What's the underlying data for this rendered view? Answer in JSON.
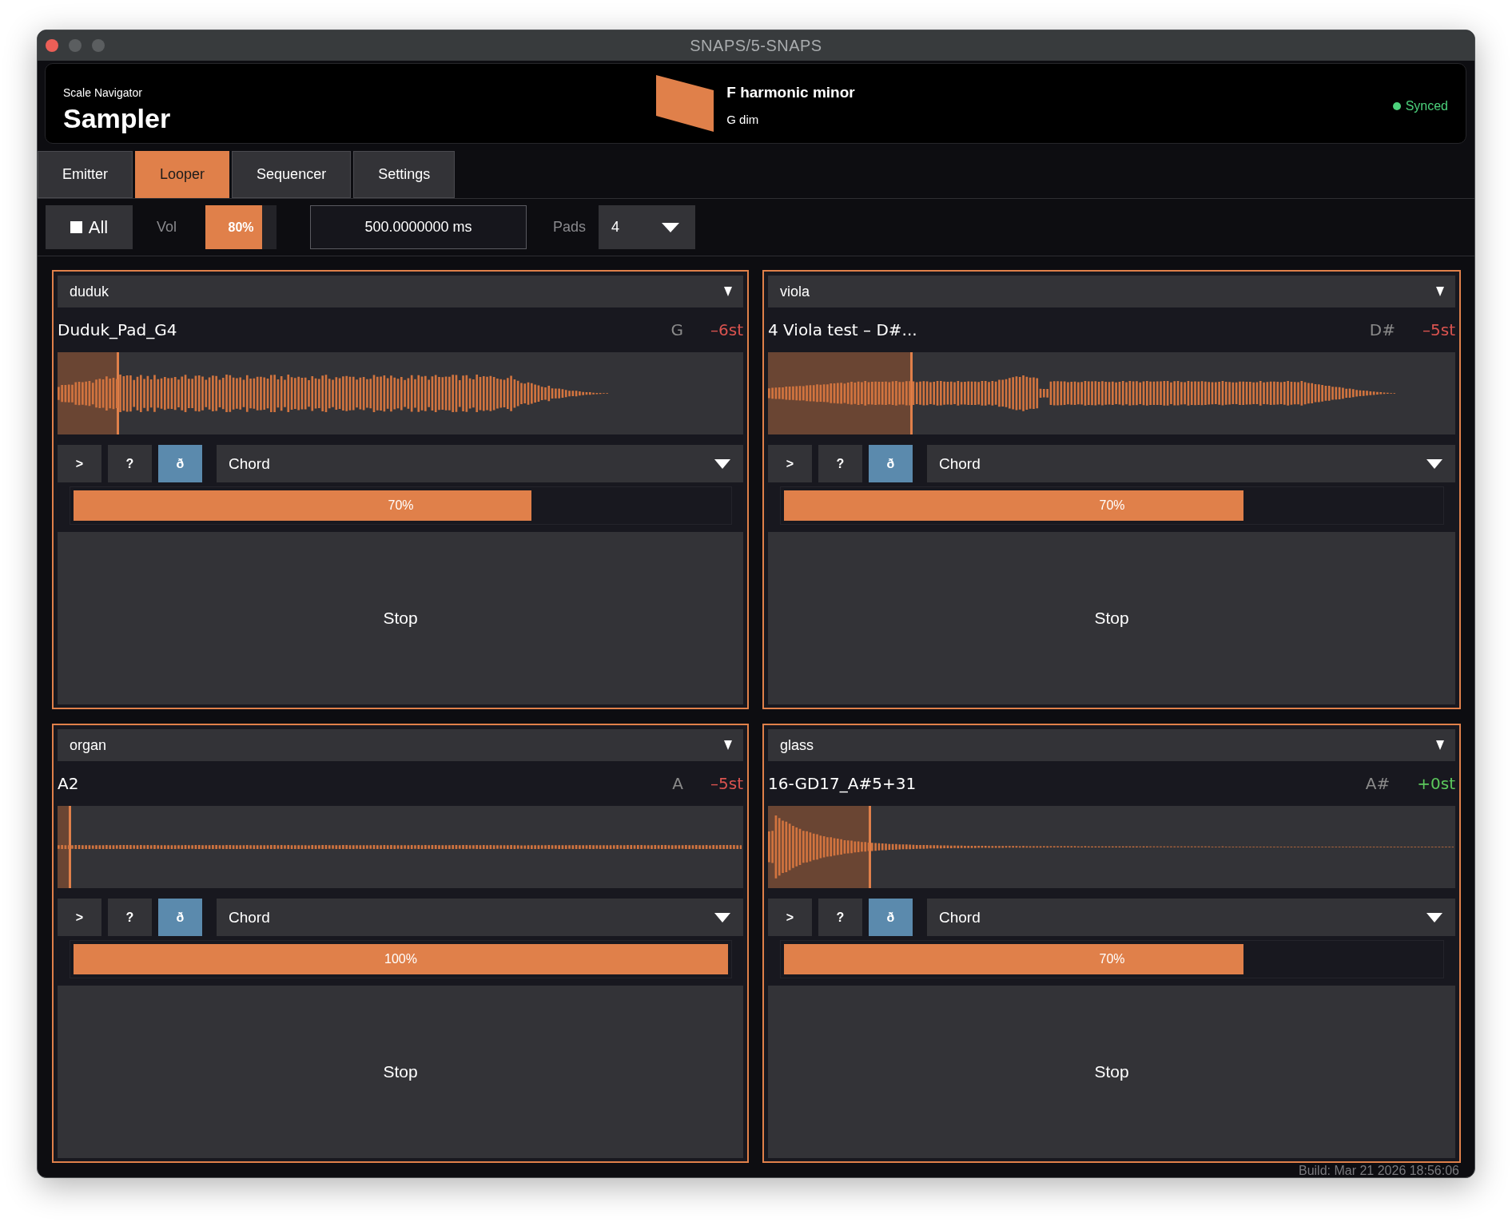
{
  "window": {
    "title": "SNAPS/5-SNAPS"
  },
  "header": {
    "subtitle": "Scale Navigator",
    "title": "Sampler",
    "scale": "F harmonic minor",
    "chord": "G dim",
    "status": {
      "label": "Synced",
      "color": "#4cd27c"
    }
  },
  "tabs": [
    {
      "label": "Emitter",
      "selected": false
    },
    {
      "label": "Looper",
      "selected": true
    },
    {
      "label": "Sequencer",
      "selected": false
    },
    {
      "label": "Settings",
      "selected": false
    }
  ],
  "toolbar": {
    "all": {
      "label": "All",
      "checked": false
    },
    "volume": {
      "label": "Vol",
      "level": 0.8,
      "reading": "80%"
    },
    "interval": {
      "value": "500.0000000 ms"
    },
    "pads": {
      "label": "Pads",
      "value": "4"
    }
  },
  "pads": [
    {
      "instrument": "duduk",
      "sample": "Duduk_Pad_G4",
      "note": "G",
      "transpose": {
        "text": "–6st",
        "color": "#d9534f"
      },
      "waveform": {
        "kind": "swell"
      },
      "loop": {
        "level": 0.09
      },
      "buttons": [
        {
          "label": ">",
          "on": false
        },
        {
          "label": "?",
          "on": false
        },
        {
          "label": "ð",
          "on": true
        }
      ],
      "mode": "Chord",
      "velocity": {
        "level": 0.7,
        "reading": "70%"
      },
      "action": "Stop"
    },
    {
      "instrument": "viola",
      "sample": "4 Viola test – D#...",
      "note": "D#",
      "transpose": {
        "text": "–5st",
        "color": "#d9534f"
      },
      "waveform": {
        "kind": "bowed"
      },
      "loop": {
        "level": 0.21
      },
      "buttons": [
        {
          "label": ">",
          "on": false
        },
        {
          "label": "?",
          "on": false
        },
        {
          "label": "ð",
          "on": true
        }
      ],
      "mode": "Chord",
      "velocity": {
        "level": 0.7,
        "reading": "70%"
      },
      "action": "Stop"
    },
    {
      "instrument": "organ",
      "sample": "A2",
      "note": "A",
      "transpose": {
        "text": "–5st",
        "color": "#d9534f"
      },
      "waveform": {
        "kind": "drone"
      },
      "loop": {
        "level": 0.02
      },
      "buttons": [
        {
          "label": ">",
          "on": false
        },
        {
          "label": "?",
          "on": false
        },
        {
          "label": "ð",
          "on": true
        }
      ],
      "mode": "Chord",
      "velocity": {
        "level": 1,
        "reading": "100%"
      },
      "action": "Stop"
    },
    {
      "instrument": "glass",
      "sample": "16-GD17_A#5+31",
      "note": "A#",
      "transpose": {
        "text": "+0st",
        "color": "#5cc85c"
      },
      "waveform": {
        "kind": "decay"
      },
      "loop": {
        "level": 0.15
      },
      "buttons": [
        {
          "label": ">",
          "on": false
        },
        {
          "label": "?",
          "on": false
        },
        {
          "label": "ð",
          "on": true
        }
      ],
      "mode": "Chord",
      "velocity": {
        "level": 0.7,
        "reading": "70%"
      },
      "action": "Stop"
    }
  ],
  "build": "Build: Mar 21 2026 18:56:06"
}
